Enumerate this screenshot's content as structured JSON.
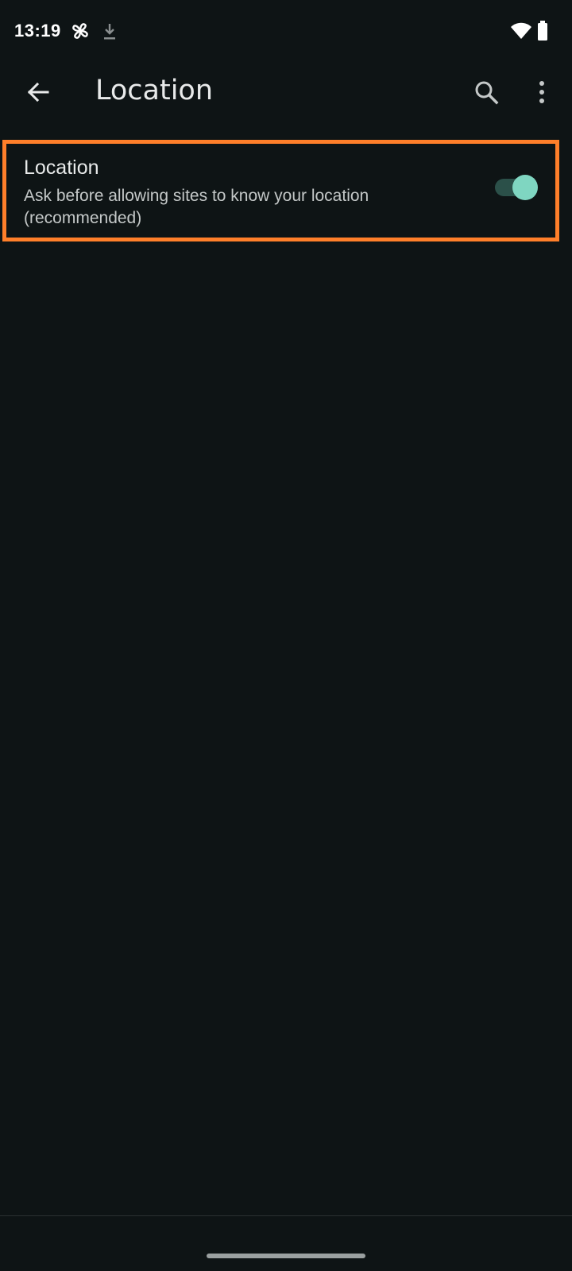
{
  "status_bar": {
    "time": "13:19",
    "icons": [
      "fan-icon",
      "download-icon",
      "wifi-icon",
      "battery-icon"
    ]
  },
  "app_bar": {
    "title": "Location",
    "icons": [
      "back-arrow-icon",
      "search-icon",
      "more-vert-icon"
    ]
  },
  "setting": {
    "title": "Location",
    "summary": "Ask before allowing sites to know your location (recommended)",
    "toggle_on": true
  },
  "colors": {
    "background": "#0e1415",
    "highlight_border": "#ff7f2a",
    "toggle_thumb": "#7fd6c1",
    "toggle_track": "#2b5049"
  }
}
